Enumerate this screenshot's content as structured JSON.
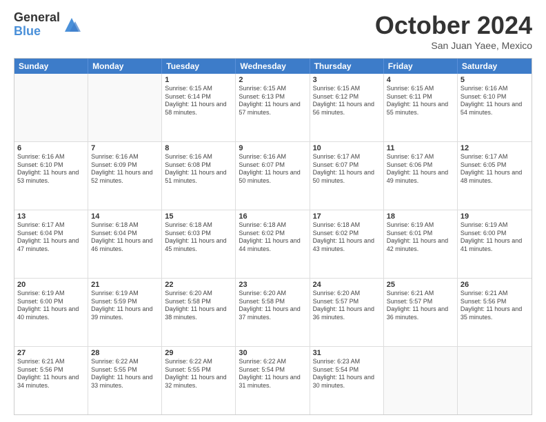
{
  "logo": {
    "general": "General",
    "blue": "Blue"
  },
  "header": {
    "month": "October 2024",
    "location": "San Juan Yaee, Mexico"
  },
  "weekdays": [
    "Sunday",
    "Monday",
    "Tuesday",
    "Wednesday",
    "Thursday",
    "Friday",
    "Saturday"
  ],
  "weeks": [
    [
      {
        "day": "",
        "info": ""
      },
      {
        "day": "",
        "info": ""
      },
      {
        "day": "1",
        "info": "Sunrise: 6:15 AM\nSunset: 6:14 PM\nDaylight: 11 hours and 58 minutes."
      },
      {
        "day": "2",
        "info": "Sunrise: 6:15 AM\nSunset: 6:13 PM\nDaylight: 11 hours and 57 minutes."
      },
      {
        "day": "3",
        "info": "Sunrise: 6:15 AM\nSunset: 6:12 PM\nDaylight: 11 hours and 56 minutes."
      },
      {
        "day": "4",
        "info": "Sunrise: 6:15 AM\nSunset: 6:11 PM\nDaylight: 11 hours and 55 minutes."
      },
      {
        "day": "5",
        "info": "Sunrise: 6:16 AM\nSunset: 6:10 PM\nDaylight: 11 hours and 54 minutes."
      }
    ],
    [
      {
        "day": "6",
        "info": "Sunrise: 6:16 AM\nSunset: 6:10 PM\nDaylight: 11 hours and 53 minutes."
      },
      {
        "day": "7",
        "info": "Sunrise: 6:16 AM\nSunset: 6:09 PM\nDaylight: 11 hours and 52 minutes."
      },
      {
        "day": "8",
        "info": "Sunrise: 6:16 AM\nSunset: 6:08 PM\nDaylight: 11 hours and 51 minutes."
      },
      {
        "day": "9",
        "info": "Sunrise: 6:16 AM\nSunset: 6:07 PM\nDaylight: 11 hours and 50 minutes."
      },
      {
        "day": "10",
        "info": "Sunrise: 6:17 AM\nSunset: 6:07 PM\nDaylight: 11 hours and 50 minutes."
      },
      {
        "day": "11",
        "info": "Sunrise: 6:17 AM\nSunset: 6:06 PM\nDaylight: 11 hours and 49 minutes."
      },
      {
        "day": "12",
        "info": "Sunrise: 6:17 AM\nSunset: 6:05 PM\nDaylight: 11 hours and 48 minutes."
      }
    ],
    [
      {
        "day": "13",
        "info": "Sunrise: 6:17 AM\nSunset: 6:04 PM\nDaylight: 11 hours and 47 minutes."
      },
      {
        "day": "14",
        "info": "Sunrise: 6:18 AM\nSunset: 6:04 PM\nDaylight: 11 hours and 46 minutes."
      },
      {
        "day": "15",
        "info": "Sunrise: 6:18 AM\nSunset: 6:03 PM\nDaylight: 11 hours and 45 minutes."
      },
      {
        "day": "16",
        "info": "Sunrise: 6:18 AM\nSunset: 6:02 PM\nDaylight: 11 hours and 44 minutes."
      },
      {
        "day": "17",
        "info": "Sunrise: 6:18 AM\nSunset: 6:02 PM\nDaylight: 11 hours and 43 minutes."
      },
      {
        "day": "18",
        "info": "Sunrise: 6:19 AM\nSunset: 6:01 PM\nDaylight: 11 hours and 42 minutes."
      },
      {
        "day": "19",
        "info": "Sunrise: 6:19 AM\nSunset: 6:00 PM\nDaylight: 11 hours and 41 minutes."
      }
    ],
    [
      {
        "day": "20",
        "info": "Sunrise: 6:19 AM\nSunset: 6:00 PM\nDaylight: 11 hours and 40 minutes."
      },
      {
        "day": "21",
        "info": "Sunrise: 6:19 AM\nSunset: 5:59 PM\nDaylight: 11 hours and 39 minutes."
      },
      {
        "day": "22",
        "info": "Sunrise: 6:20 AM\nSunset: 5:58 PM\nDaylight: 11 hours and 38 minutes."
      },
      {
        "day": "23",
        "info": "Sunrise: 6:20 AM\nSunset: 5:58 PM\nDaylight: 11 hours and 37 minutes."
      },
      {
        "day": "24",
        "info": "Sunrise: 6:20 AM\nSunset: 5:57 PM\nDaylight: 11 hours and 36 minutes."
      },
      {
        "day": "25",
        "info": "Sunrise: 6:21 AM\nSunset: 5:57 PM\nDaylight: 11 hours and 36 minutes."
      },
      {
        "day": "26",
        "info": "Sunrise: 6:21 AM\nSunset: 5:56 PM\nDaylight: 11 hours and 35 minutes."
      }
    ],
    [
      {
        "day": "27",
        "info": "Sunrise: 6:21 AM\nSunset: 5:56 PM\nDaylight: 11 hours and 34 minutes."
      },
      {
        "day": "28",
        "info": "Sunrise: 6:22 AM\nSunset: 5:55 PM\nDaylight: 11 hours and 33 minutes."
      },
      {
        "day": "29",
        "info": "Sunrise: 6:22 AM\nSunset: 5:55 PM\nDaylight: 11 hours and 32 minutes."
      },
      {
        "day": "30",
        "info": "Sunrise: 6:22 AM\nSunset: 5:54 PM\nDaylight: 11 hours and 31 minutes."
      },
      {
        "day": "31",
        "info": "Sunrise: 6:23 AM\nSunset: 5:54 PM\nDaylight: 11 hours and 30 minutes."
      },
      {
        "day": "",
        "info": ""
      },
      {
        "day": "",
        "info": ""
      }
    ]
  ]
}
